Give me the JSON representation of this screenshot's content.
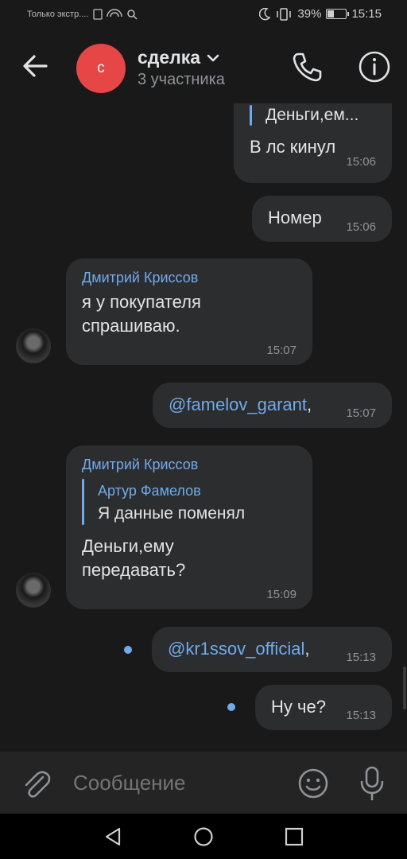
{
  "status_bar": {
    "left_text": "Только экстр....",
    "battery": "39%",
    "time": "15:15"
  },
  "header": {
    "avatar_letter": "с",
    "title": "сделка",
    "subtitle": "3 участника"
  },
  "messages": [
    {
      "reply_preview": "Деньги,ем...",
      "text": "В лс кинул",
      "time": "15:06",
      "outgoing": true
    },
    {
      "text": "Номер",
      "time": "15:06",
      "outgoing": true
    },
    {
      "sender": "Дмитрий Криссов",
      "text_line1": "я у покупателя",
      "text_line2": "спрашиваю.",
      "time": "15:07",
      "outgoing": false
    },
    {
      "text": "@famelov_garant",
      "suffix": ",",
      "time": "15:07",
      "outgoing": true
    },
    {
      "sender": "Дмитрий Криссов",
      "reply_author": "Артур Фамелов",
      "reply_text": "Я данные поменял",
      "text_line1": "Деньги,ему",
      "text_line2": "передавать?",
      "time": "15:09",
      "outgoing": false
    },
    {
      "text": "@kr1ssov_official",
      "suffix": ",",
      "time": "15:13",
      "outgoing": true,
      "unread": true
    },
    {
      "text": "Ну че?",
      "time": "15:13",
      "outgoing": true,
      "unread": true
    }
  ],
  "composer": {
    "placeholder": "Сообщение"
  },
  "colors": {
    "background": "#19191a",
    "bubble": "#2c2d2e",
    "accent": "#71aaeb",
    "avatar": "#e64646"
  },
  "icons": [
    "back-arrow-icon",
    "chevron-down-icon",
    "phone-icon",
    "info-icon",
    "attach-icon",
    "emoji-icon",
    "mic-icon",
    "nav-back-icon",
    "nav-home-icon",
    "nav-recents-icon"
  ]
}
